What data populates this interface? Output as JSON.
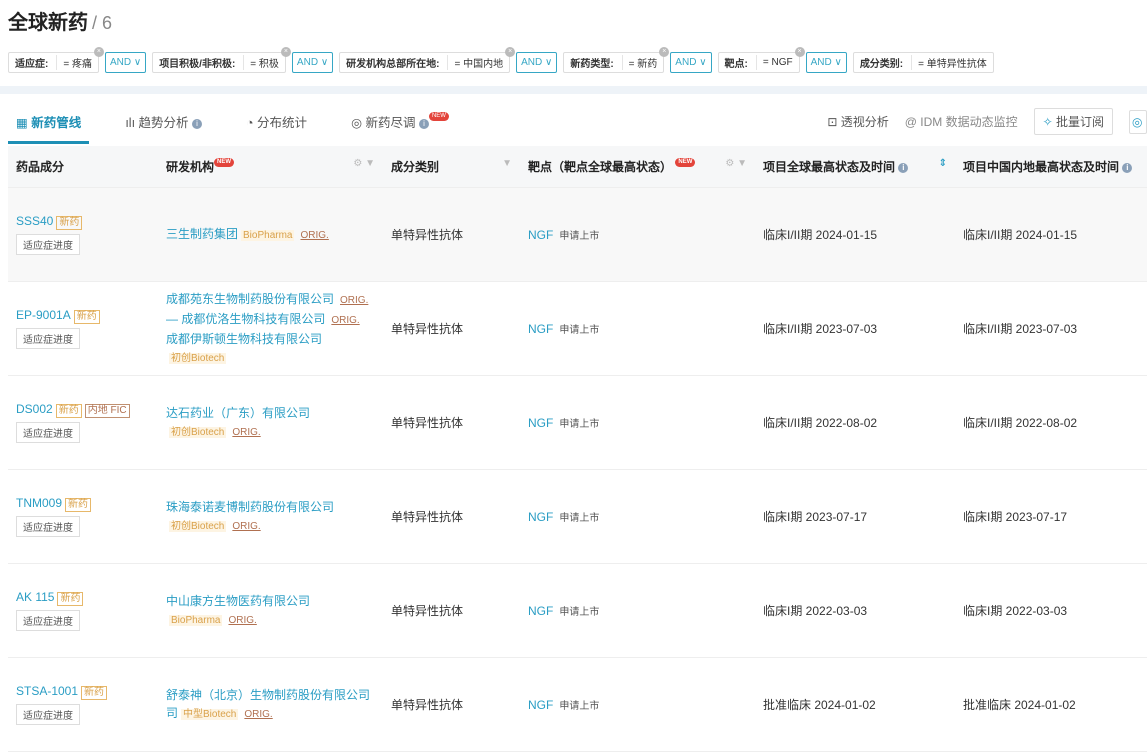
{
  "header": {
    "title": "全球新药",
    "count": "/ 6"
  },
  "filters": [
    {
      "label": "适应症:",
      "value": "= 疼痛"
    },
    {
      "label": "项目积极/非积极:",
      "value": "= 积极"
    },
    {
      "label": "研发机构总部所在地:",
      "value": "= 中国内地"
    },
    {
      "label": "新药类型:",
      "value": "= 新药"
    },
    {
      "label": "靶点:",
      "value": "= NGF"
    },
    {
      "label": "成分类别:",
      "value": "= 单特异性抗体"
    }
  ],
  "and_label": "AND ∨",
  "tabs": [
    "新药管线",
    "趋势分析",
    "分布统计",
    "新药尽调"
  ],
  "new_badge": "NEW",
  "tools": {
    "pivot": "透视分析",
    "idm": "IDM 数据动态监控",
    "subscribe": "批量订阅"
  },
  "columns": [
    "药品成分",
    "研发机构",
    "成分类别",
    "靶点（靶点全球最高状态）",
    "项目全球最高状态及时间",
    "项目中国内地最高状态及时间"
  ],
  "progress_label": "适应症进度",
  "rows": [
    {
      "drug": "SSS40",
      "tags": [
        "新药"
      ],
      "orgs": [
        {
          "name": "三生制药集团",
          "bio": "BioPharma",
          "orig": "ORIG."
        }
      ],
      "category": "单特异性抗体",
      "target": "NGF",
      "target_status": "申请上市",
      "global": "临床I/II期 2024-01-15",
      "china": "临床I/II期 2024-01-15"
    },
    {
      "drug": "EP-9001A",
      "tags": [
        "新药"
      ],
      "orgs": [
        {
          "name": "成都苑东生物制药股份有限公司",
          "orig": "ORIG."
        },
        {
          "name": "— 成都优洛生物科技有限公司",
          "orig": "ORIG."
        },
        {
          "name": "成都伊斯顿生物科技有限公司"
        }
      ],
      "extra_bio": "初创Biotech",
      "category": "单特异性抗体",
      "target": "NGF",
      "target_status": "申请上市",
      "global": "临床I/II期 2023-07-03",
      "china": "临床I/II期 2023-07-03"
    },
    {
      "drug": "DS002",
      "tags": [
        "新药",
        "内地 FIC"
      ],
      "orgs": [
        {
          "name": "达石药业（广东）有限公司"
        }
      ],
      "extra_bio": "初创Biotech",
      "extra_orig": "ORIG.",
      "category": "单特异性抗体",
      "target": "NGF",
      "target_status": "申请上市",
      "global": "临床I/II期 2022-08-02",
      "china": "临床I/II期 2022-08-02"
    },
    {
      "drug": "TNM009",
      "tags": [
        "新药"
      ],
      "orgs": [
        {
          "name": "珠海泰诺麦博制药股份有限公司"
        }
      ],
      "extra_bio": "初创Biotech",
      "extra_orig": "ORIG.",
      "category": "单特异性抗体",
      "target": "NGF",
      "target_status": "申请上市",
      "global": "临床I期 2023-07-17",
      "china": "临床I期 2023-07-17"
    },
    {
      "drug": "AK 115",
      "tags": [
        "新药"
      ],
      "orgs": [
        {
          "name": "中山康方生物医药有限公司"
        }
      ],
      "extra_bio": "BioPharma",
      "extra_orig": "ORIG.",
      "category": "单特异性抗体",
      "target": "NGF",
      "target_status": "申请上市",
      "global": "临床I期 2022-03-03",
      "china": "临床I期 2022-03-03"
    },
    {
      "drug": "STSA-1001",
      "tags": [
        "新药"
      ],
      "orgs": [
        {
          "name": "舒泰神（北京）生物制药股份有限公司"
        }
      ],
      "tail": "司",
      "extra_bio": "中型Biotech",
      "extra_orig": "ORIG.",
      "category": "单特异性抗体",
      "target": "NGF",
      "target_status": "申请上市",
      "global": "批准临床 2024-01-02",
      "china": "批准临床 2024-01-02"
    }
  ]
}
